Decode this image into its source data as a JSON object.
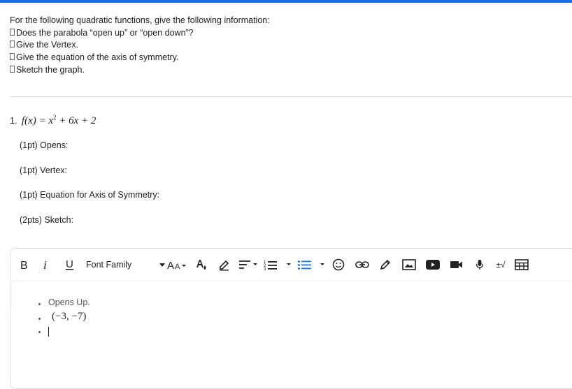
{
  "instructions": {
    "intro": "For the following quadratic functions, give the following information:",
    "items": [
      "Does the parabola “open up” or “open down”?",
      "Give the Vertex.",
      "Give the equation of the axis of symmetry.",
      "Sketch the graph."
    ]
  },
  "question": {
    "number": "1.",
    "function_name": "f(x) = x",
    "exponent": "2",
    "function_rest": " + 6x + 2",
    "fields": [
      "(1pt) Opens:",
      "(1pt) Vertex:",
      "(1pt)  Equation for Axis of Symmetry:",
      "(2pts)  Sketch:"
    ]
  },
  "toolbar": {
    "font_family_label": "Font Family",
    "math_label": "±√",
    "icons": [
      "bold-icon",
      "italic-icon",
      "underline-icon",
      "font-size-icon",
      "text-color-icon",
      "highlight-icon",
      "align-icon",
      "numbered-list-icon",
      "bulleted-list-icon",
      "emoji-icon",
      "link-icon",
      "draw-icon",
      "image-icon",
      "youtube-icon",
      "video-icon",
      "microphone-icon",
      "math-icon",
      "table-icon"
    ],
    "active_color": "#1a73e8"
  },
  "answer": {
    "bullets": [
      "Opens Up.",
      "(−3, −7)",
      ""
    ]
  }
}
